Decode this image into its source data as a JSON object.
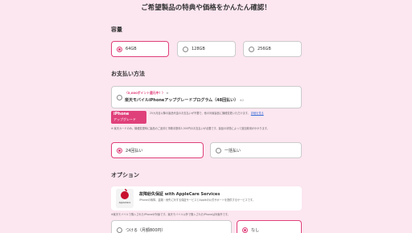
{
  "headline": "ご希望製品の特典や価格をかんたん確認！",
  "capacity": {
    "title": "容量",
    "options": [
      {
        "label": "64GB",
        "selected": true
      },
      {
        "label": "128GB",
        "selected": false
      },
      {
        "label": "256GB",
        "selected": false
      }
    ]
  },
  "payment": {
    "title": "お支払い方法",
    "promo_line": "〈5,000ポイント還元中！〉",
    "promo_note": "※",
    "promo_name": "楽天モバイルiPhoneアップグレードプログラム（48回払い）",
    "promo_name_note": "※2",
    "badge_line1": "iPhone",
    "badge_line2": "アップグレード",
    "badge_text": "25カ月目以降の製品代金のお支払いが不要で、他の対象製品に機種変更いただけます。",
    "badge_link": "詳細を見る",
    "fine_print": "※ 楽天カードのみ。機種変更時に製品のご返却と事務手数料3,300円のお支払いが必要です。製品の状態によって追加費用がかかります。",
    "options": [
      {
        "label": "24回払い",
        "selected": true
      },
      {
        "label": "一括払い",
        "selected": false
      }
    ]
  },
  "option": {
    "title": "オプション",
    "applecare_title": "故障紛失保証 with AppleCare Services",
    "applecare_desc": "iPhoneの故障、盗難・紛失に対する保証サービスとAppleの公式サポートを提供するサービスです。",
    "applecare_logo_label": "AppleCare",
    "note": "※楽天モバイルで購入されたiPhoneが対象です。楽天モバイル以外で購入されたiPhoneは対象外です。",
    "choices": [
      {
        "label": "つける（月額800円）",
        "selected": false
      },
      {
        "label": "なし",
        "selected": true
      }
    ]
  },
  "colors": {
    "accent": "#e0407a",
    "background": "#fce6f0"
  }
}
